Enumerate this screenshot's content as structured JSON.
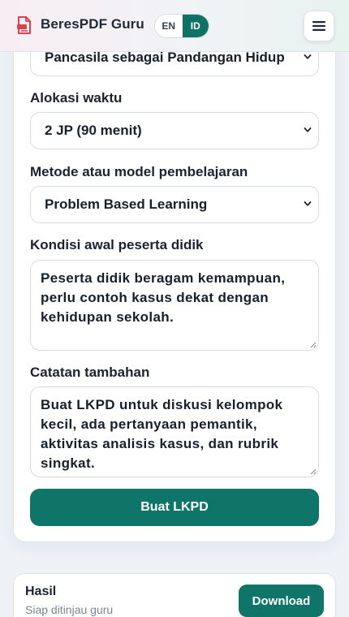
{
  "header": {
    "brand": "BeresPDF Guru",
    "logo_icon": "pdf-document-icon",
    "languages": [
      "EN",
      "ID"
    ],
    "active_language": "ID",
    "menu_icon": "hamburger-menu-icon"
  },
  "form": {
    "topic_select": {
      "value": "Pancasila sebagai Pandangan Hidup"
    },
    "time": {
      "label": "Alokasi waktu",
      "value": "2 JP (90 menit)"
    },
    "method": {
      "label": "Metode atau model pembelajaran",
      "value": "Problem Based Learning"
    },
    "initial_condition": {
      "label": "Kondisi awal peserta didik",
      "value": "Peserta didik beragam kemampuan, perlu contoh kasus dekat dengan kehidupan sekolah."
    },
    "notes": {
      "label": "Catatan tambahan",
      "value": "Buat LKPD untuk diskusi kelompok kecil, ada pertanyaan pemantik, aktivitas analisis kasus, dan rubrik singkat."
    },
    "submit_label": "Buat LKPD"
  },
  "result": {
    "title": "Hasil",
    "subtitle": "Siap ditinjau guru",
    "download_label": "Download"
  },
  "colors": {
    "accent": "#0f7568",
    "logo": "#e0404a"
  }
}
